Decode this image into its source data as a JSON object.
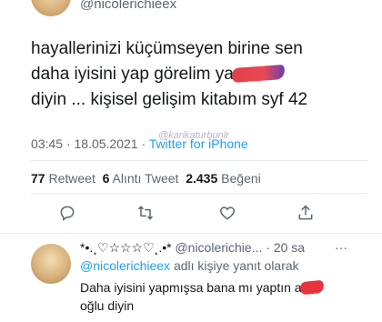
{
  "tweet": {
    "handle": "@nicolerichieex",
    "text_lines": [
      "hayallerinizi küçümseyen birine sen",
      "daha iyisini yap görelim ya",
      "diyin ... kişisel gelişim kitabım syf 42"
    ],
    "time": "03:45",
    "date": "18.05.2021",
    "source": "Twitter for iPhone",
    "watermark": "@karikaturbunlr"
  },
  "stats": {
    "retweets": "77",
    "retweets_label": "Retweet",
    "quotes": "6",
    "quotes_label": "Alıntı Tweet",
    "likes": "2.435",
    "likes_label": "Beğeni"
  },
  "actions": {
    "reply_icon": "comment-icon",
    "retweet_icon": "retweet-icon",
    "like_icon": "heart-icon",
    "share_icon": "share-icon"
  },
  "reply": {
    "name": "*•.¸♡☆☆☆♡¸.•*",
    "handle": "@nicolerichie...",
    "time": "20 sa",
    "more": "···",
    "replying_to_handle": "@nicolerichieex",
    "replying_to_suffix": "adlı kişiye yanıt olarak",
    "text_line1": "Daha iyisini yapmışsa bana mı yaptın a",
    "text_line2": "oğlu diyin"
  },
  "colors": {
    "link": "#1da1f2",
    "muted": "#5b6670",
    "text": "#14171a"
  }
}
